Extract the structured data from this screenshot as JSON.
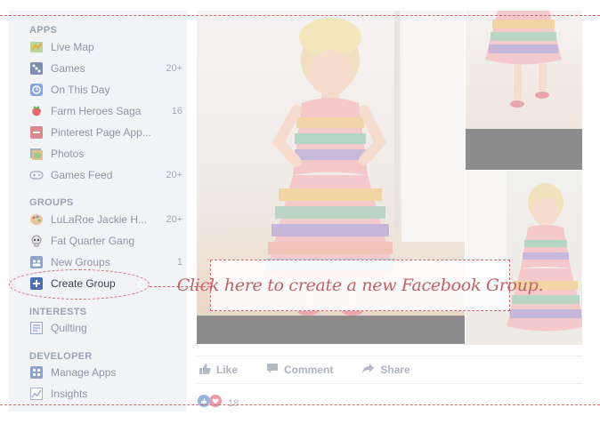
{
  "sidebar": {
    "sections": {
      "apps": "APPS",
      "groups": "GROUPS",
      "interests": "INTERESTS",
      "developer": "DEVELOPER"
    },
    "apps": [
      {
        "label": "Live Map",
        "count": "",
        "icon": "map-icon"
      },
      {
        "label": "Games",
        "count": "20+",
        "icon": "games-icon"
      },
      {
        "label": "On This Day",
        "count": "",
        "icon": "clock-icon"
      },
      {
        "label": "Farm Heroes Saga",
        "count": "16",
        "icon": "strawberry-icon"
      },
      {
        "label": "Pinterest Page App...",
        "count": "",
        "icon": "pinterest-icon"
      },
      {
        "label": "Photos",
        "count": "",
        "icon": "photos-icon"
      },
      {
        "label": "Games Feed",
        "count": "20+",
        "icon": "gamepad-icon"
      }
    ],
    "groups": [
      {
        "label": "LuLaRoe Jackie H...",
        "count": "20+",
        "icon": "palette-icon"
      },
      {
        "label": "Fat Quarter Gang",
        "count": "",
        "icon": "skull-icon"
      },
      {
        "label": "New Groups",
        "count": "1",
        "icon": "groups-icon"
      },
      {
        "label": "Create Group",
        "count": "",
        "icon": "plus-icon"
      }
    ],
    "interests": [
      {
        "label": "Quilting",
        "count": "",
        "icon": "interest-icon"
      }
    ],
    "developer": [
      {
        "label": "Manage Apps",
        "count": "",
        "icon": "apps-icon"
      },
      {
        "label": "Insights",
        "count": "",
        "icon": "insights-icon"
      }
    ]
  },
  "post": {
    "actions": {
      "like": "Like",
      "comment": "Comment",
      "share": "Share"
    },
    "reactions_count": "18"
  },
  "annotation": {
    "callout": "Click here to create a new Facebook Group."
  },
  "colors": {
    "accent_dashed": "#d36a72",
    "sidebar_bg": "#f2f3f6",
    "text_muted": "#8d95a6"
  }
}
